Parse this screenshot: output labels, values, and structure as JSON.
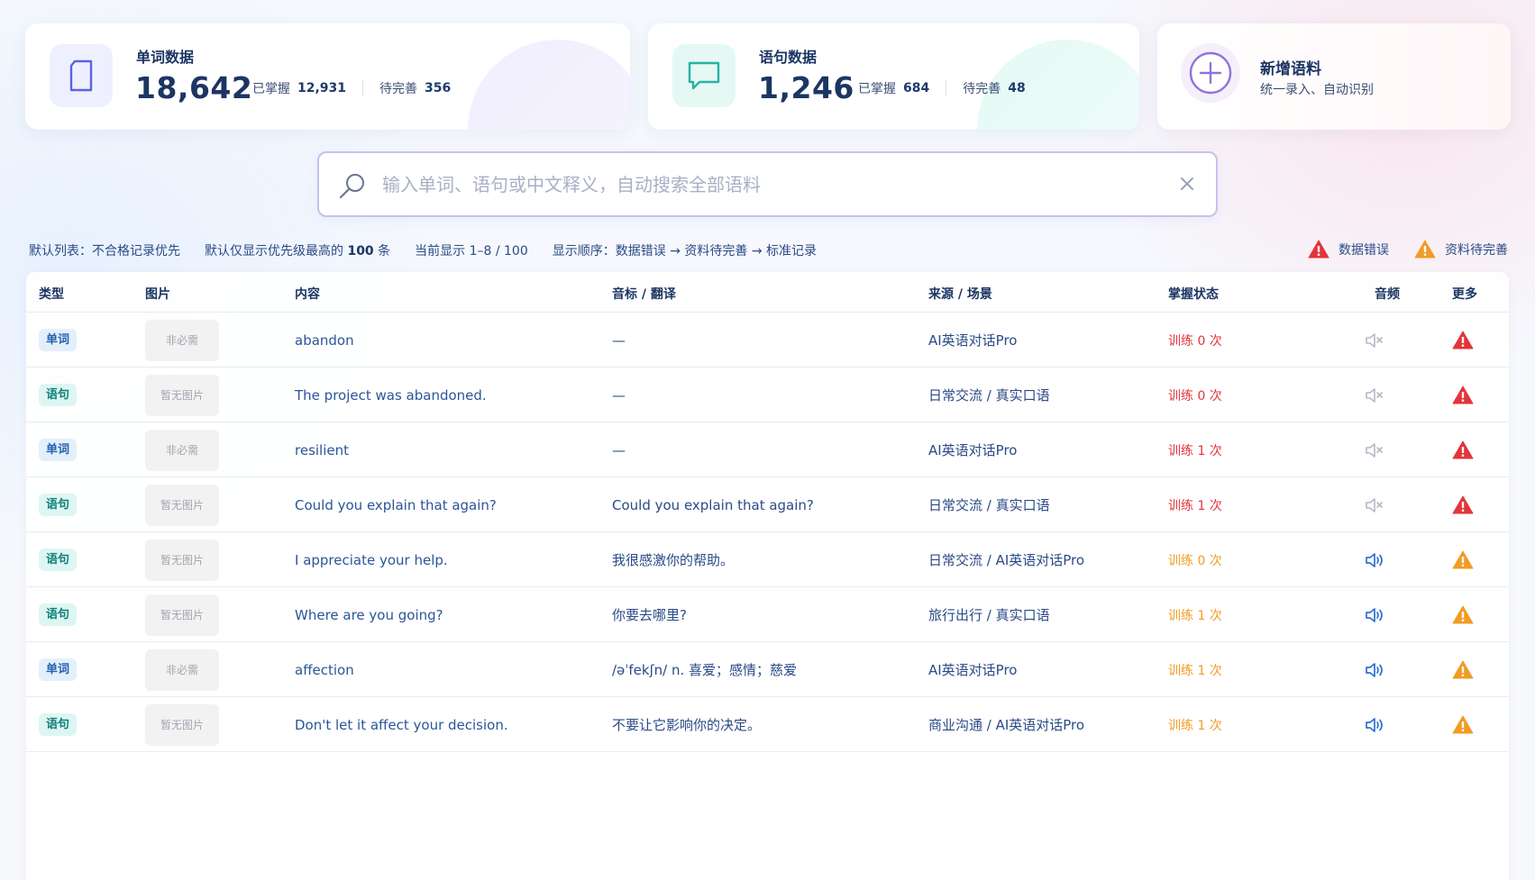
{
  "stats": {
    "words": {
      "title": "单词数据",
      "count": "18,642",
      "mastered_label": "已掌握",
      "mastered": "12,931",
      "pending_label": "待完善",
      "pending": "356"
    },
    "sentences": {
      "title": "语句数据",
      "count": "1,246",
      "mastered_label": "已掌握",
      "mastered": "684",
      "pending_label": "待完善",
      "pending": "48"
    },
    "add": {
      "title": "新增语料",
      "subtitle": "统一录入、自动识别"
    }
  },
  "search": {
    "placeholder": "输入单词、语句或中文释义，自动搜索全部语料",
    "value": ""
  },
  "info": {
    "default_list": "默认列表：不合格记录优先",
    "limit_prefix": "默认仅显示优先级最高的",
    "limit_count": "100",
    "limit_suffix": "条",
    "showing": "当前显示 1–8 / 100",
    "order": "显示顺序：数据错误 → 资料待完善 → 标准记录"
  },
  "legend": {
    "error": "数据错误",
    "pending": "资料待完善"
  },
  "colors": {
    "error": "#e4343b",
    "warning": "#f29b25",
    "accent": "#7b68d9",
    "teal": "#2bb3a6"
  },
  "table": {
    "headers": {
      "type": "类型",
      "image": "图片",
      "content": "内容",
      "phonetic": "音标 / 翻译",
      "source": "来源 / 场景",
      "status": "掌握状态",
      "audio": "音频",
      "more": "更多"
    },
    "rows": [
      {
        "type": "单词",
        "image": "非必需",
        "content": "abandon",
        "phonetic": "—",
        "source": "AI英语对话Pro",
        "status": "训练 0 次",
        "level": "error",
        "audio": "muted"
      },
      {
        "type": "语句",
        "image": "暂无图片",
        "content": "The project was abandoned.",
        "phonetic": "—",
        "source": "日常交流 / 真实口语",
        "status": "训练 0 次",
        "level": "error",
        "audio": "muted"
      },
      {
        "type": "单词",
        "image": "非必需",
        "content": "resilient",
        "phonetic": "—",
        "source": "AI英语对话Pro",
        "status": "训练 1 次",
        "level": "error",
        "audio": "muted"
      },
      {
        "type": "语句",
        "image": "暂无图片",
        "content": "Could you explain that again?",
        "phonetic": "Could you explain that again?",
        "source": "日常交流 / 真实口语",
        "status": "训练 1 次",
        "level": "error",
        "audio": "muted"
      },
      {
        "type": "语句",
        "image": "暂无图片",
        "content": "I appreciate your help.",
        "phonetic": "我很感激你的帮助。",
        "source": "日常交流 / AI英语对话Pro",
        "status": "训练 0 次",
        "level": "warning",
        "audio": "available"
      },
      {
        "type": "语句",
        "image": "暂无图片",
        "content": "Where are you going?",
        "phonetic": "你要去哪里?",
        "source": "旅行出行 / 真实口语",
        "status": "训练 1 次",
        "level": "warning",
        "audio": "available"
      },
      {
        "type": "单词",
        "image": "非必需",
        "content": "affection",
        "phonetic": "/əˈfekʃn/   n. 喜爱；感情；慈爱",
        "source": "AI英语对话Pro",
        "status": "训练 1 次",
        "level": "warning",
        "audio": "available"
      },
      {
        "type": "语句",
        "image": "暂无图片",
        "content": "Don't let it affect your decision.",
        "phonetic": "不要让它影响你的决定。",
        "source": "商业沟通 / AI英语对话Pro",
        "status": "训练 1 次",
        "level": "warning",
        "audio": "available"
      }
    ]
  }
}
